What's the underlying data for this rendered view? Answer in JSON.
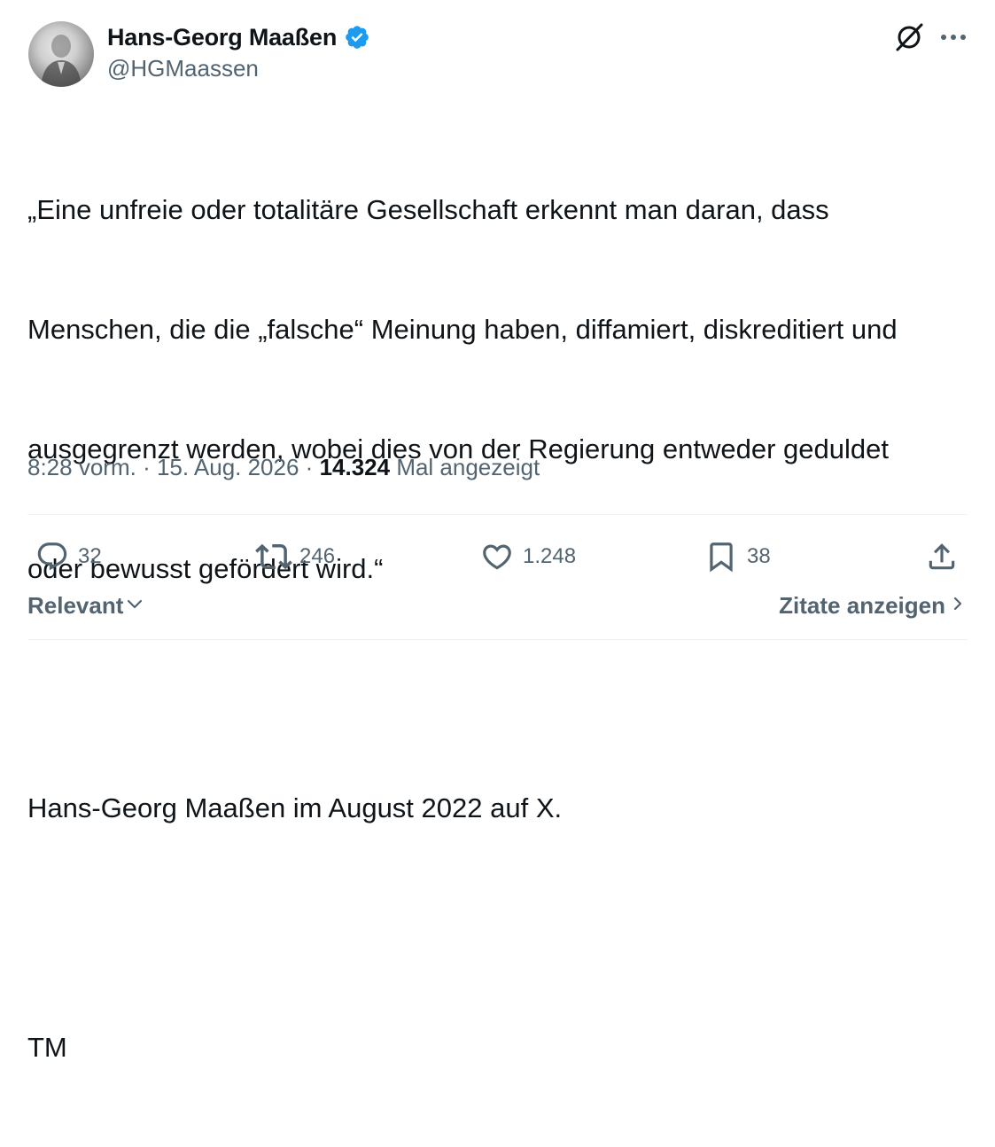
{
  "author": {
    "display_name": "Hans-Georg Maaßen",
    "handle": "@HGMaassen",
    "verified": true,
    "verified_color": "#1d9bf0"
  },
  "tweet": {
    "lines": [
      "„Eine unfreie oder totalitäre Gesellschaft erkennt man daran, dass",
      "Menschen, die die „falsche“ Meinung haben, diffamiert, diskreditiert und",
      "ausgegrenzt werden, wobei dies von der Regierung entweder geduldet",
      "oder bewusst gefördert wird.“"
    ],
    "attribution": "Hans-Georg Maaßen im August 2022 auf X.",
    "signature": "TM"
  },
  "meta": {
    "time": "8:28 vorm.",
    "separator": "·",
    "date": "15. Aug. 2026",
    "views_count": "14.324",
    "views_label": "Mal angezeigt"
  },
  "actions": {
    "replies": "32",
    "reposts": "246",
    "likes": "1.248",
    "bookmarks": "38"
  },
  "footer": {
    "sort_label": "Relevant",
    "quotes_label": "Zitate anzeigen"
  },
  "icons": {
    "grok": "grok-icon",
    "more": "more-icon",
    "reply": "reply-icon",
    "repost": "repost-icon",
    "like": "heart-icon",
    "bookmark": "bookmark-icon",
    "share": "share-icon"
  },
  "colors": {
    "text_primary": "#0f1419",
    "text_secondary": "#536471",
    "divider": "#eff3f4"
  }
}
